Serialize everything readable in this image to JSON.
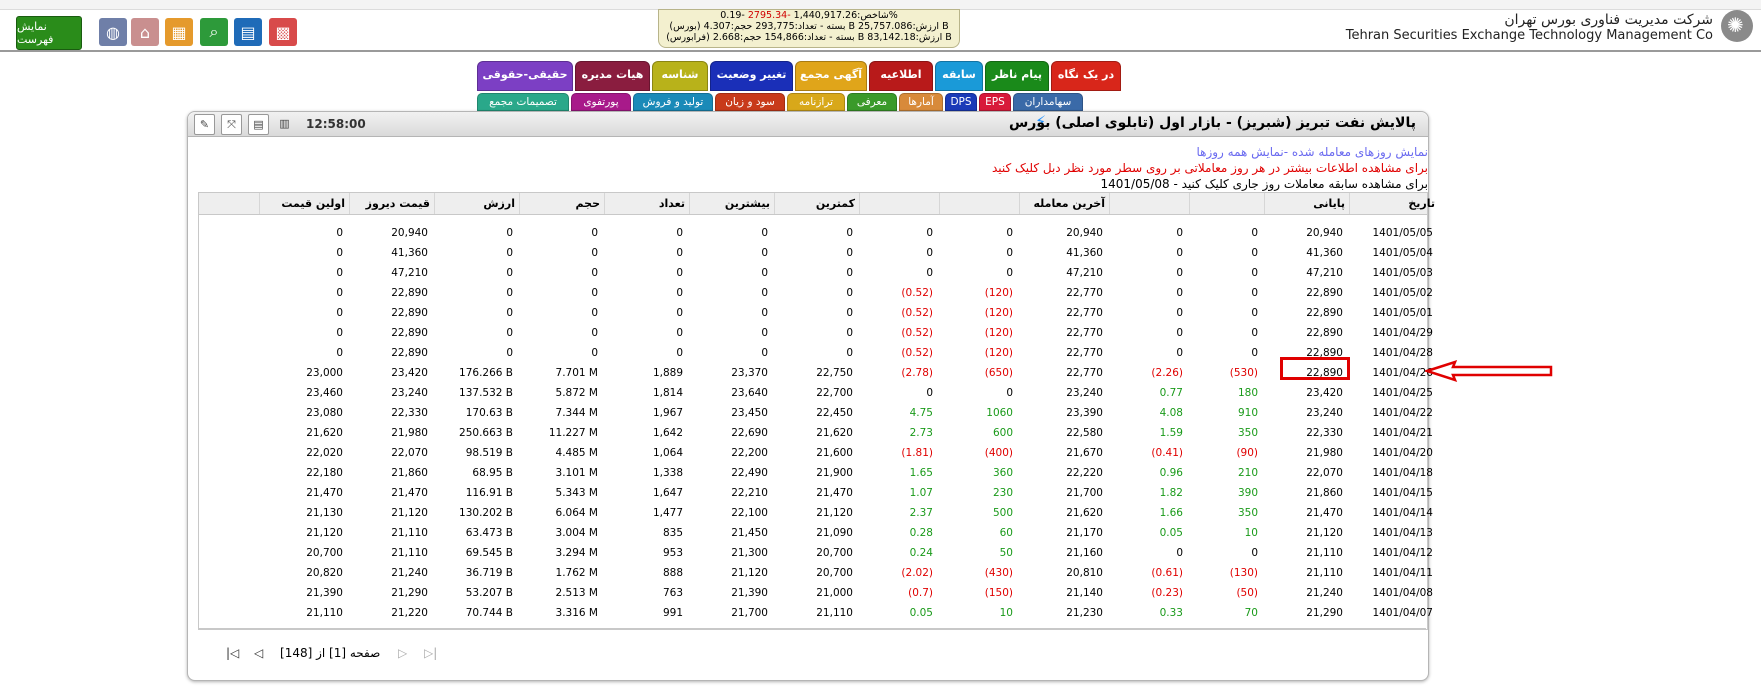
{
  "header": {
    "company_fa": "شرکت مدیریت فناوری بورس تهران",
    "company_en": "Tehran Securities Exchange Technology Management Co",
    "show_list_label": "نمایش فهرست",
    "ticker": {
      "line1_prefix": "شاخص:",
      "line1_index": "1,440,917.26",
      "line1_change": "-2795.34",
      "line1_pct": "-0.19%",
      "line2": "(بورس) بسته - تعداد:293,775 حجم:4.307 B ارزش:25,757.086 B",
      "line3": "(فرابورس) بسته - تعداد:154,866 حجم:2.668 B ارزش:83,142.18 B"
    }
  },
  "tabs": {
    "row1": [
      "در یک نگاه",
      "پیام ناظر",
      "سابقه",
      "اطلاعیه",
      "آگهی مجمع",
      "تغییر وضعیت",
      "شناسه",
      "هیات مدیره",
      "حقیقی-حقوقی"
    ],
    "row2": [
      "سهامداران",
      "EPS",
      "DPS",
      "آمارها",
      "معرفی",
      "ترازنامه",
      "سود و زیان",
      "تولید و فروش",
      "پورتفوی",
      "تصمیمات مجمع"
    ]
  },
  "panel": {
    "title": "پالایش نفت تبریز (شبریز) - بازار اول (تابلوی اصلی) بورس",
    "clock": "12:58:00",
    "info_link": "نمایش روزهای معامله شده -نمایش همه روزها",
    "info_red": "برای مشاهده اطلاعات بیشتر در هر روز معاملاتی بر روی سطر مورد نظر دبل کلیک کنید",
    "info_black": "1401/05/08 - برای مشاهده سابقه معاملات روز جاری کلیک کنید"
  },
  "table": {
    "columns": [
      "تاریخ",
      "پایانی",
      "",
      "",
      "آخرین معامله",
      "",
      "",
      "کمترین",
      "بیشترین",
      "تعداد",
      "حجم",
      "ارزش",
      "قیمت دیروز",
      "اولین قیمت"
    ],
    "rows": [
      [
        "1401/05/05",
        "20,940",
        "0",
        "0",
        "20,940",
        "0",
        "0",
        "0",
        "0",
        "0",
        "0",
        "0",
        "20,940",
        "0"
      ],
      [
        "1401/05/04",
        "41,360",
        "0",
        "0",
        "41,360",
        "0",
        "0",
        "0",
        "0",
        "0",
        "0",
        "0",
        "41,360",
        "0"
      ],
      [
        "1401/05/03",
        "47,210",
        "0",
        "0",
        "47,210",
        "0",
        "0",
        "0",
        "0",
        "0",
        "0",
        "0",
        "47,210",
        "0"
      ],
      [
        "1401/05/02",
        "22,890",
        "0",
        "0",
        "22,770",
        "(120)",
        "(0.52)",
        "0",
        "0",
        "0",
        "0",
        "0",
        "22,890",
        "0"
      ],
      [
        "1401/05/01",
        "22,890",
        "0",
        "0",
        "22,770",
        "(120)",
        "(0.52)",
        "0",
        "0",
        "0",
        "0",
        "0",
        "22,890",
        "0"
      ],
      [
        "1401/04/29",
        "22,890",
        "0",
        "0",
        "22,770",
        "(120)",
        "(0.52)",
        "0",
        "0",
        "0",
        "0",
        "0",
        "22,890",
        "0"
      ],
      [
        "1401/04/28",
        "22,890",
        "0",
        "0",
        "22,770",
        "(120)",
        "(0.52)",
        "0",
        "0",
        "0",
        "0",
        "0",
        "22,890",
        "0"
      ],
      [
        "1401/04/26",
        "22,890",
        "(530)",
        "(2.26)",
        "22,770",
        "(650)",
        "(2.78)",
        "22,750",
        "23,370",
        "1,889",
        "7.701 M",
        "176.266 B",
        "23,420",
        "23,000"
      ],
      [
        "1401/04/25",
        "23,420",
        "180",
        "0.77",
        "23,240",
        "0",
        "0",
        "22,700",
        "23,640",
        "1,814",
        "5.872 M",
        "137.532 B",
        "23,240",
        "23,460"
      ],
      [
        "1401/04/22",
        "23,240",
        "910",
        "4.08",
        "23,390",
        "1060",
        "4.75",
        "22,450",
        "23,450",
        "1,967",
        "7.344 M",
        "170.63 B",
        "22,330",
        "23,080"
      ],
      [
        "1401/04/21",
        "22,330",
        "350",
        "1.59",
        "22,580",
        "600",
        "2.73",
        "21,620",
        "22,690",
        "1,642",
        "11.227 M",
        "250.663 B",
        "21,980",
        "21,620"
      ],
      [
        "1401/04/20",
        "21,980",
        "(90)",
        "(0.41)",
        "21,670",
        "(400)",
        "(1.81)",
        "21,600",
        "22,200",
        "1,064",
        "4.485 M",
        "98.519 B",
        "22,070",
        "22,020"
      ],
      [
        "1401/04/18",
        "22,070",
        "210",
        "0.96",
        "22,220",
        "360",
        "1.65",
        "21,900",
        "22,490",
        "1,338",
        "3.101 M",
        "68.95 B",
        "21,860",
        "22,180"
      ],
      [
        "1401/04/15",
        "21,860",
        "390",
        "1.82",
        "21,700",
        "230",
        "1.07",
        "21,470",
        "22,210",
        "1,647",
        "5.343 M",
        "116.91 B",
        "21,470",
        "21,470"
      ],
      [
        "1401/04/14",
        "21,470",
        "350",
        "1.66",
        "21,620",
        "500",
        "2.37",
        "21,120",
        "22,100",
        "1,477",
        "6.064 M",
        "130.202 B",
        "21,120",
        "21,130"
      ],
      [
        "1401/04/13",
        "21,120",
        "10",
        "0.05",
        "21,170",
        "60",
        "0.28",
        "21,090",
        "21,450",
        "835",
        "3.004 M",
        "63.473 B",
        "21,110",
        "21,120"
      ],
      [
        "1401/04/12",
        "21,110",
        "0",
        "0",
        "21,160",
        "50",
        "0.24",
        "20,700",
        "21,300",
        "953",
        "3.294 M",
        "69.545 B",
        "21,110",
        "20,700"
      ],
      [
        "1401/04/11",
        "21,110",
        "(130)",
        "(0.61)",
        "20,810",
        "(430)",
        "(2.02)",
        "20,700",
        "21,120",
        "888",
        "1.762 M",
        "36.719 B",
        "21,240",
        "20,820"
      ],
      [
        "1401/04/08",
        "21,240",
        "(50)",
        "(0.23)",
        "21,140",
        "(150)",
        "(0.7)",
        "21,000",
        "21,390",
        "763",
        "2.513 M",
        "53.207 B",
        "21,290",
        "21,390"
      ],
      [
        "1401/04/07",
        "21,290",
        "70",
        "0.33",
        "21,230",
        "10",
        "0.05",
        "21,110",
        "21,700",
        "991",
        "3.316 M",
        "70.744 B",
        "21,220",
        "21,110"
      ]
    ]
  },
  "pager": {
    "text": "صفحه [1] از [148]"
  },
  "colors": {
    "negative": "#e00000",
    "positive": "#1a9a1a"
  }
}
